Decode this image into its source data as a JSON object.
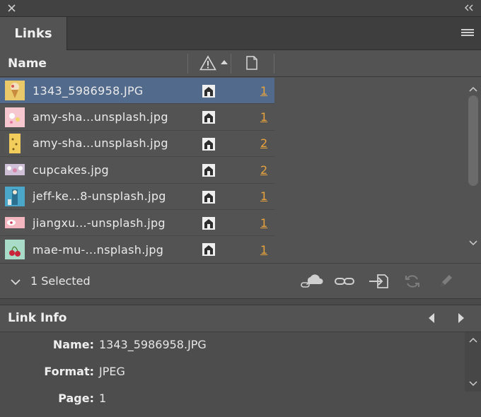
{
  "tab": {
    "label": "Links"
  },
  "columns": {
    "name": "Name"
  },
  "links": [
    {
      "file": "1343_5986958.JPG",
      "page": "1",
      "selected": true
    },
    {
      "file": "amy-sha...unsplash.jpg",
      "page": "1",
      "selected": false
    },
    {
      "file": "amy-sha...unsplash.jpg",
      "page": "2",
      "selected": false
    },
    {
      "file": "cupcakes.jpg",
      "page": "2",
      "selected": false
    },
    {
      "file": "jeff-ke...8-unsplash.jpg",
      "page": "1",
      "selected": false
    },
    {
      "file": "jiangxu...-unsplash.jpg",
      "page": "1",
      "selected": false
    },
    {
      "file": "mae-mu-...nsplash.jpg",
      "page": "1",
      "selected": false
    }
  ],
  "footer": {
    "selected_count": "1 Selected"
  },
  "link_info": {
    "title": "Link Info",
    "fields": [
      {
        "label": "Name:",
        "value": "1343_5986958.JPG"
      },
      {
        "label": "Format:",
        "value": "JPEG"
      },
      {
        "label": "Page:",
        "value": "1"
      }
    ]
  },
  "colors": {
    "selected_row": "#526a8c",
    "page_link": "#e8a33c",
    "panel_bg": "#535353"
  }
}
